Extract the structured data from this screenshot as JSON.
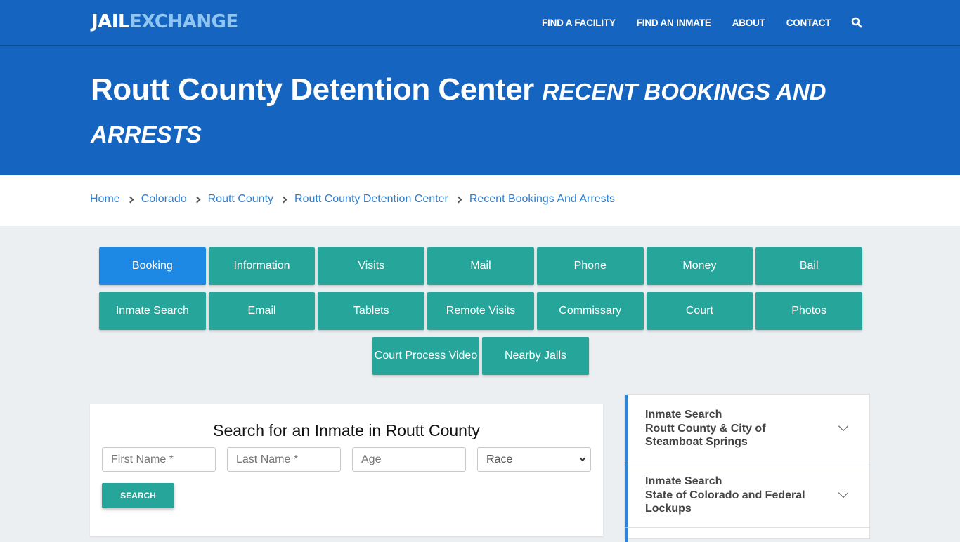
{
  "header": {
    "logo": {
      "part1": "JAIL",
      "part2": "EXCHANGE"
    },
    "nav": [
      "FIND A FACILITY",
      "FIND AN INMATE",
      "ABOUT",
      "CONTACT"
    ],
    "search_icon": "search-icon"
  },
  "hero": {
    "title": "Routt County Detention Center",
    "subtitle": "RECENT BOOKINGS AND ARRESTS"
  },
  "breadcrumb": [
    "Home",
    "Colorado",
    "Routt County",
    "Routt County Detention Center",
    "Recent Bookings And Arrests"
  ],
  "tabs": {
    "row1": [
      "Booking",
      "Information",
      "Visits",
      "Mail",
      "Phone",
      "Money",
      "Bail"
    ],
    "row2": [
      "Inmate Search",
      "Email",
      "Tablets",
      "Remote Visits",
      "Commissary",
      "Court",
      "Photos"
    ],
    "row3": [
      "Court Process Video",
      "Nearby Jails"
    ],
    "active": "Booking"
  },
  "search": {
    "title": "Search for an Inmate in Routt County",
    "first_name_placeholder": "First Name *",
    "last_name_placeholder": "Last Name *",
    "age_placeholder": "Age",
    "race_selected": "Race",
    "button": "SEARCH"
  },
  "sidebar": {
    "items": [
      {
        "line1": "Inmate Search",
        "line2": "Routt County & City of Steamboat Springs"
      },
      {
        "line1": "Inmate Search",
        "line2": "State of Colorado and Federal Lockups"
      }
    ]
  },
  "colors": {
    "brand_blue": "#1565c0",
    "teal": "#26a69a",
    "active_blue": "#1e88e5",
    "link": "#2f7fd1"
  }
}
